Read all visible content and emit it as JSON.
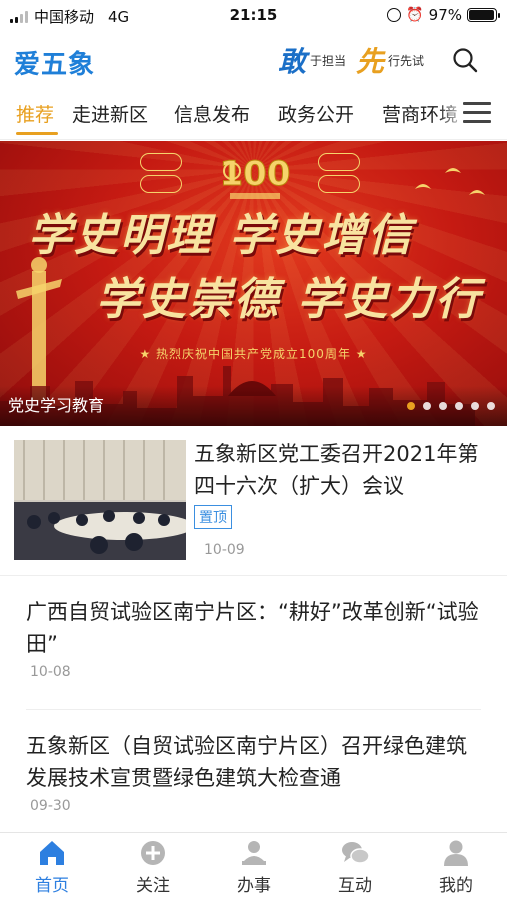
{
  "status_bar": {
    "carrier": "中国移动",
    "network": "4G",
    "time": "21:15",
    "battery_pct": "97%",
    "battery_level": 0.97
  },
  "header": {
    "logo": "爱五象",
    "slogan_char1": "敢",
    "slogan_text1": "于担当",
    "slogan_char2": "先",
    "slogan_text2": "行先试",
    "search_icon": "search-icon"
  },
  "tabs": [
    {
      "label": "推荐",
      "active": true
    },
    {
      "label": "走进新区"
    },
    {
      "label": "信息发布"
    },
    {
      "label": "政务公开"
    },
    {
      "label": "营商环境"
    }
  ],
  "banner": {
    "line1": "学史明理 学史增信",
    "line2": "学史崇德 学史力行",
    "subline": "★ 热烈庆祝中国共产党成立100周年 ★",
    "caption": "党史学习教育",
    "slide_count": 6,
    "active_slide": 1
  },
  "news": [
    {
      "title": "五象新区党工委召开2021年第四十六次（扩大）会议",
      "pinned_label": "置顶",
      "date": "10-09"
    },
    {
      "title": "广西自贸试验区南宁片区：“耕好”改革创新“试验田”",
      "date": "10-08"
    },
    {
      "title": "五象新区（自贸试验区南宁片区）召开绿色建筑发展技术宣贯暨绿色建筑大检查通",
      "date": "09-30"
    }
  ],
  "bottom_nav": [
    {
      "label": "首页",
      "icon": "home-icon",
      "active": true
    },
    {
      "label": "关注",
      "icon": "plus-circle-icon"
    },
    {
      "label": "办事",
      "icon": "person-desk-icon"
    },
    {
      "label": "互动",
      "icon": "chat-bubbles-icon"
    },
    {
      "label": "我的",
      "icon": "user-icon"
    }
  ],
  "colors": {
    "brand_blue": "#1f7fd8",
    "accent_gold": "#e8a020",
    "banner_red": "#c51a12",
    "nav_active": "#2d7fe0"
  }
}
